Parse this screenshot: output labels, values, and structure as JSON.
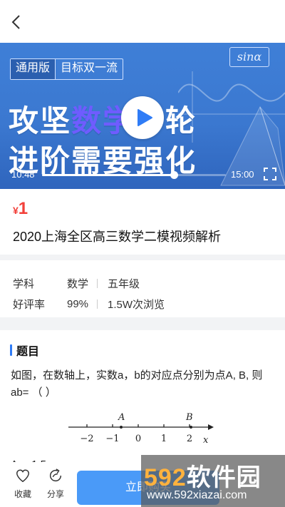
{
  "video": {
    "badge_general": "通用版",
    "badge_target": "目标双一流",
    "formula_tag": "sinα",
    "headline_line1_a": "攻坚",
    "headline_line1_b": "数学",
    "headline_line1_c": "一轮",
    "headline_line2": "进阶需要强化",
    "current_time": "10:48",
    "total_time": "15:00",
    "progress": 0.72
  },
  "course": {
    "currency": "¥",
    "price": "1",
    "title": "2020上海全区高三数学二模视频解析"
  },
  "meta": {
    "subject_label": "学科",
    "subject_value": "数学",
    "grade_value": "五年级",
    "rating_label": "好评率",
    "rating_value": "99%",
    "views_value": "1.5W次浏览"
  },
  "question": {
    "heading": "题目",
    "text": "如图，在数轴上，实数a，b的对应点分别为点A, B, 则ab=  （          ）",
    "numberline": {
      "ticks": [
        "−2",
        "−1",
        "0",
        "1",
        "2"
      ],
      "point_a": "A",
      "point_b": "B",
      "axis_label": "x"
    },
    "option_a": "A、 1.5"
  },
  "bottom": {
    "favorite_label": "收藏",
    "share_label": "分享",
    "buy_label": "立即购买"
  },
  "watermark": {
    "logo_num": "592",
    "logo_text": "软件园",
    "url": "www.592xiazai.com"
  },
  "colors": {
    "accent": "#2f7cf6",
    "price": "#f2403a",
    "button": "#4a9af8",
    "video_bg": "#3f7fd7"
  }
}
